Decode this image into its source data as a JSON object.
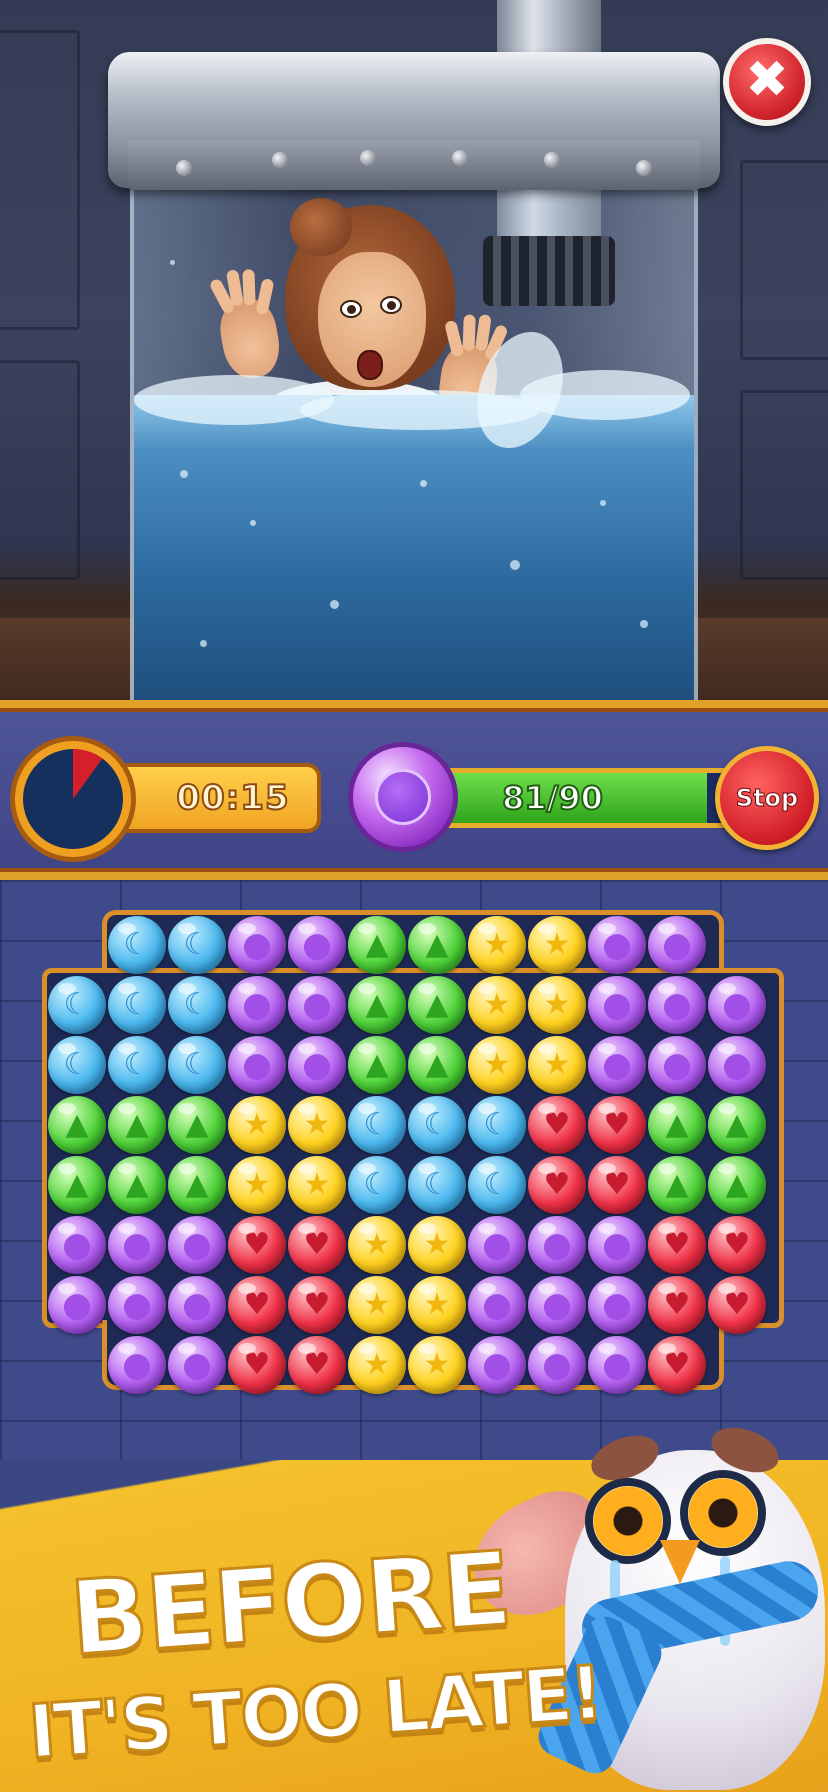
{
  "hud": {
    "timer": "00:15",
    "timer_elapsed_fraction": 0.1,
    "progress_text": "81/90",
    "progress_fraction": 0.9,
    "stop_label": "Stop"
  },
  "close_button": {
    "icon": "close-x-icon",
    "symbol": "✖"
  },
  "board": {
    "gem_types": {
      "B": {
        "color": "blue",
        "icon": "moon-icon",
        "symbol": "☾"
      },
      "P": {
        "color": "purple",
        "icon": "circle-icon",
        "symbol": "●"
      },
      "G": {
        "color": "green",
        "icon": "triangle-icon",
        "symbol": "▲"
      },
      "Y": {
        "color": "yellow",
        "icon": "star-icon",
        "symbol": "★"
      },
      "R": {
        "color": "red",
        "icon": "heart-icon",
        "symbol": "♥"
      }
    },
    "rows": [
      "-BBPPGGYYPP-",
      "BBBPPGGYYPPP",
      "BBBPPGGYYPPP",
      "GGGYYBBBRRGG",
      "GGGYYBBBRRGG",
      "PPPRRYYPPPRR",
      "PPPRRYYPPPRR",
      "-PPRRYYPPPR-"
    ]
  },
  "banner": {
    "line1": "BEFORE",
    "line2": "IT'S TOO LATE!"
  },
  "colors": {
    "hud_bg": "#4f5698",
    "hud_border": "#e1a22a",
    "banner_bg": "#f4c02c",
    "stop_red": "#d3202a",
    "progress_green": "#4fd33a"
  }
}
